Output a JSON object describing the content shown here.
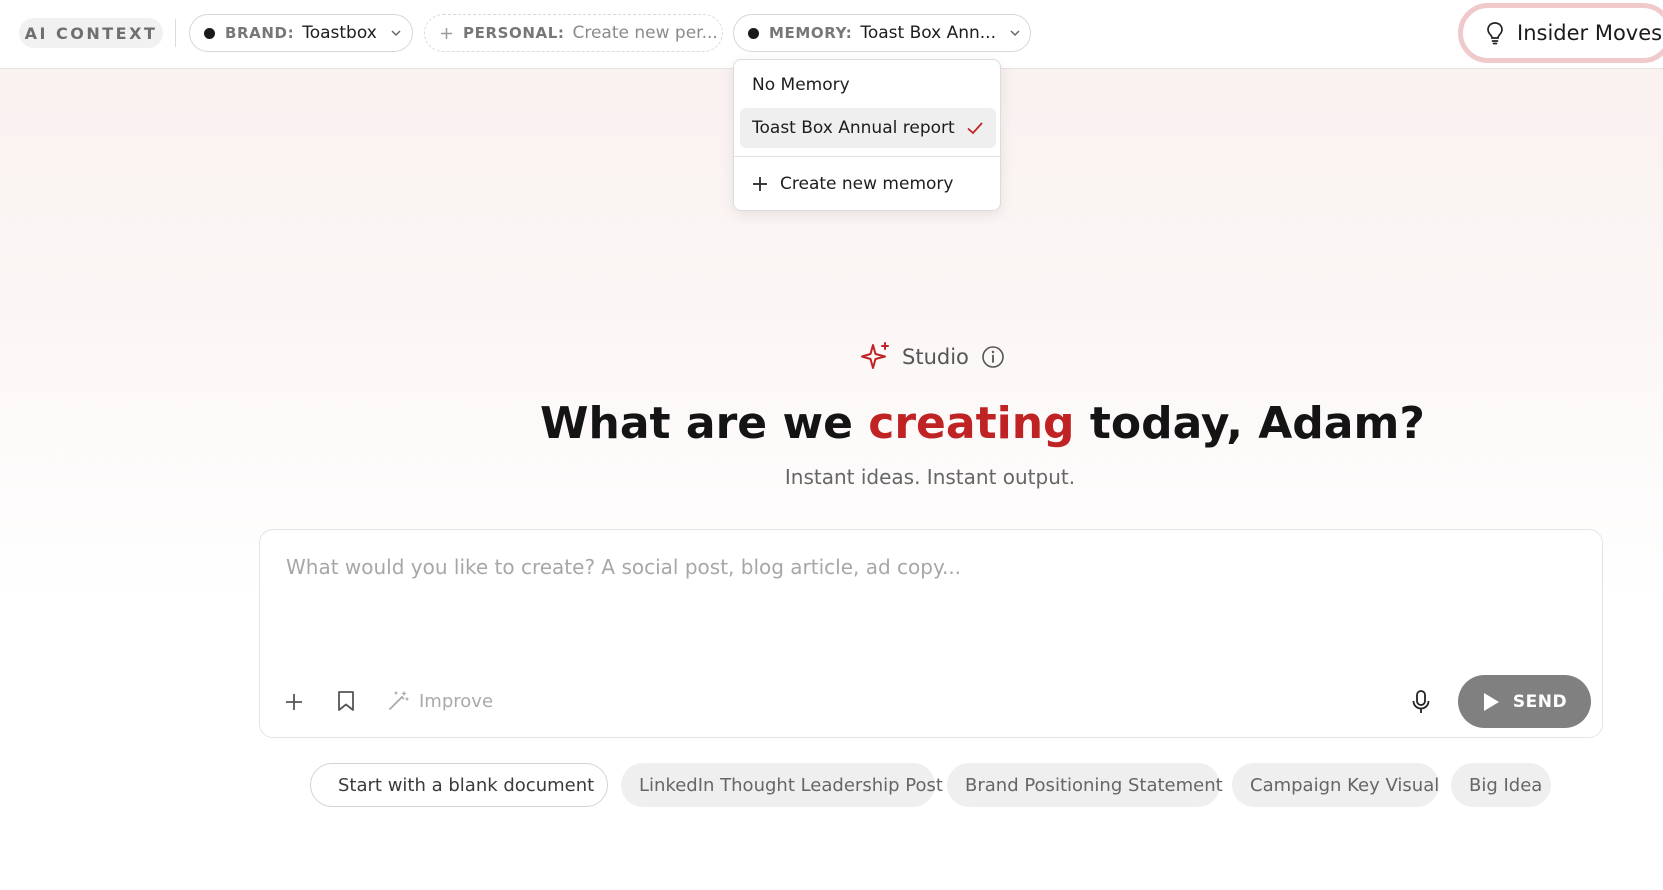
{
  "topbar": {
    "ai_context_label": "AI CONTEXT",
    "brand": {
      "key": "BRAND:",
      "value": "Toastbox"
    },
    "personal": {
      "key": "PERSONAL:",
      "value": "Create new per..."
    },
    "memory": {
      "key": "MEMORY:",
      "value": "Toast Box Ann..."
    },
    "insider_moves_label": "Insider Moves"
  },
  "memory_menu": {
    "items": [
      {
        "label": "No Memory",
        "selected": false
      },
      {
        "label": "Toast Box Annual report",
        "selected": true
      }
    ],
    "create_label": "Create new memory"
  },
  "hero": {
    "studio_label": "Studio",
    "headline_before": "What are we ",
    "headline_accent": "creating",
    "headline_after": " today, Adam?",
    "tagline": "Instant ideas. Instant output."
  },
  "composer": {
    "placeholder": "What would you like to create? A social post, blog article, ad copy...",
    "value": "",
    "improve_label": "Improve",
    "send_label": "SEND"
  },
  "suggestions": [
    "Start with a blank document",
    "LinkedIn Thought Leadership Post",
    "Brand Positioning Statement",
    "Campaign Key Visual",
    "Big Idea"
  ],
  "colors": {
    "accent": "#c02323",
    "insider_ring": "#f0c9cb",
    "send_bg": "#808080"
  }
}
